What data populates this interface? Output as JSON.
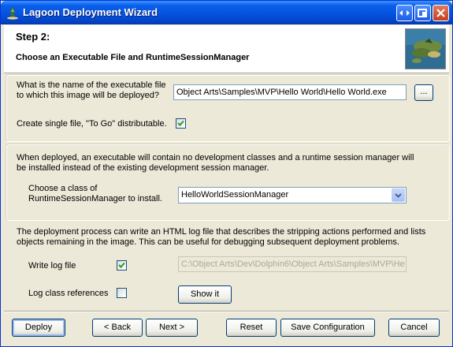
{
  "window": {
    "title": "Lagoon Deployment Wizard"
  },
  "header": {
    "step": "Step 2:",
    "subtitle": "Choose an Executable File and RuntimeSessionManager"
  },
  "exe_section": {
    "question_line1": "What is the name of the executable file",
    "question_line2": "to which this image will be deployed?",
    "exe_path": "Object Arts\\Samples\\MVP\\Hello World\\Hello World.exe",
    "browse_label": "...",
    "to_go_label": "Create single file, \"To Go\" distributable.",
    "to_go_checked": true
  },
  "session_section": {
    "description_line1": "When deployed, an executable will contain no development classes and a runtime session manager will",
    "description_line2": "be installed instead of the existing development session manager.",
    "choose_line1": "Choose a class of",
    "choose_line2": "RuntimeSessionManager to install.",
    "selected_class": "HelloWorldSessionManager"
  },
  "log_section": {
    "description_line1": "The deployment process can write an HTML log file that describes the stripping actions performed and lists",
    "description_line2": "objects remaining in the image. This can be useful for debugging subsequent deployment problems.",
    "write_log_label": "Write log file",
    "write_log_checked": true,
    "log_path": "C:\\Object Arts\\Dev\\Dolphin6\\Object Arts\\Samples\\MVP\\He",
    "log_refs_label": "Log class references",
    "log_refs_checked": false,
    "show_it_label": "Show it"
  },
  "footer": {
    "deploy": "Deploy",
    "back": "< Back",
    "next": "Next >",
    "reset": "Reset",
    "save_config": "Save Configuration",
    "cancel": "Cancel"
  }
}
